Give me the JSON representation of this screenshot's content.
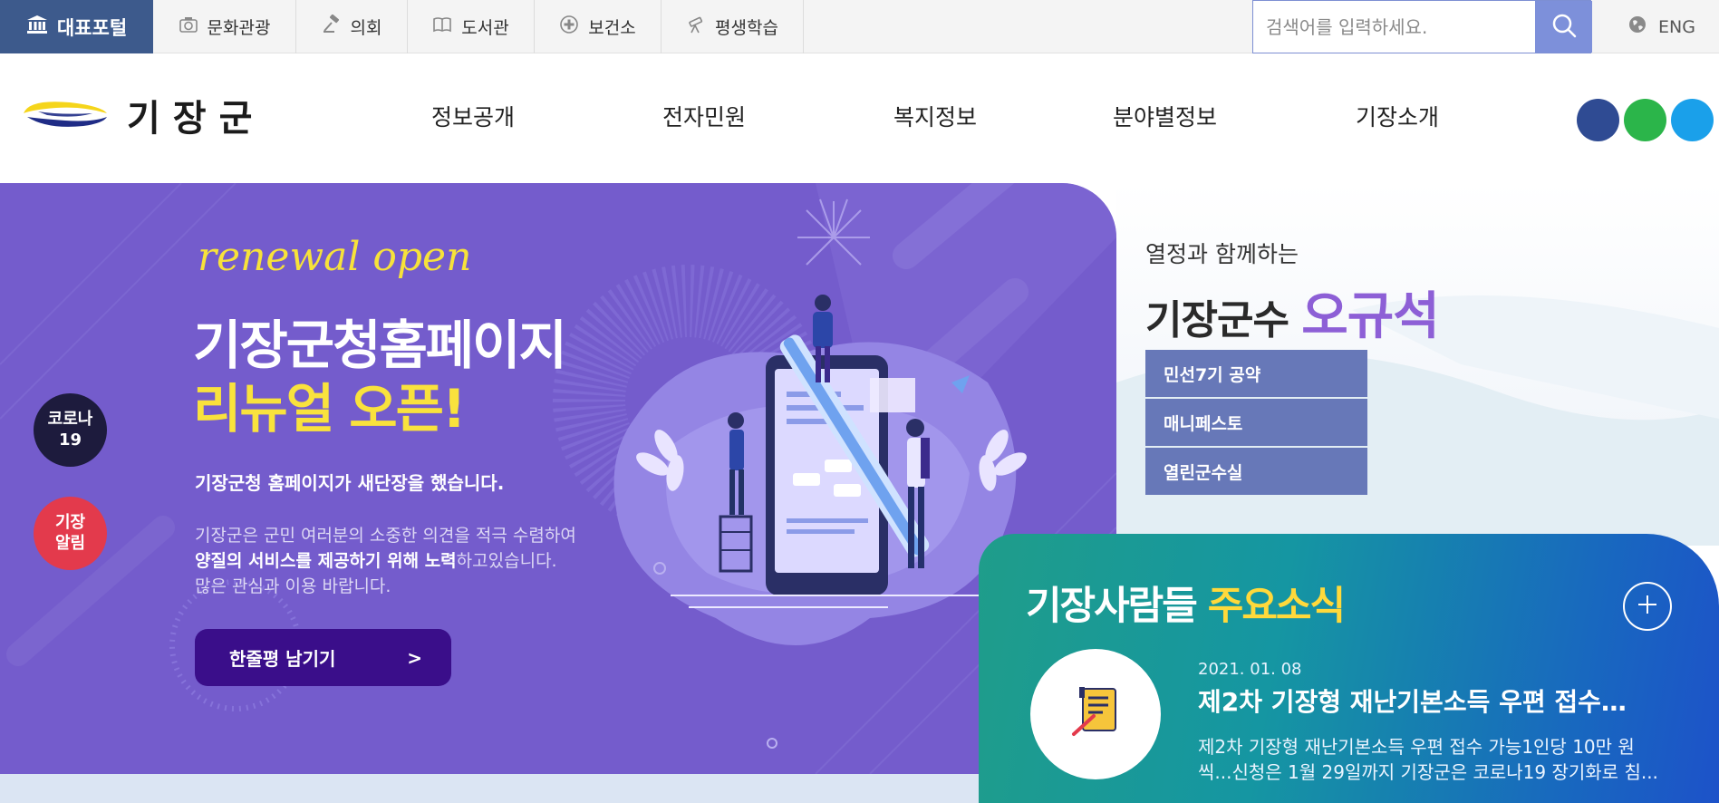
{
  "top_bar": {
    "portal_tab": "대표포털",
    "items": [
      {
        "label": "문화관광",
        "icon": "camera-icon"
      },
      {
        "label": "의회",
        "icon": "gavel-icon"
      },
      {
        "label": "도서관",
        "icon": "book-icon"
      },
      {
        "label": "보건소",
        "icon": "medical-cross-icon"
      },
      {
        "label": "평생학습",
        "icon": "telescope-icon"
      }
    ],
    "search_placeholder": "검색어를 입력하세요.",
    "language": "ENG"
  },
  "header": {
    "logo_text": "기장군",
    "nav": [
      "정보공개",
      "전자민원",
      "복지정보",
      "분야별정보",
      "기장소개"
    ],
    "social_colors": [
      "#2f4b93",
      "#2bb54a",
      "#1aa0ea"
    ]
  },
  "banner": {
    "script_title": "renewal open",
    "headline_1": "기장군청홈페이지",
    "headline_2": "리뉴얼 오픈!",
    "lead": "기장군청 홈페이지가 새단장을 했습니다.",
    "desc_1": "기장군은 군민 여러분의 소중한 의견을 적극 수렴하여",
    "desc_2_bold": "양질의 서비스를 제공하기 위해 노력",
    "desc_2_rest": "하고있습니다.",
    "desc_3": "많은 관심과 이용 바랍니다.",
    "button_label": "한줄평 남기기",
    "button_arrow": ">",
    "background_color": "#745ccc"
  },
  "side_buttons": {
    "covid_line1": "코로나",
    "covid_line2": "19",
    "notice_line1": "기장",
    "notice_line2": "알림"
  },
  "mayor": {
    "subtitle": "열정과 함께하는",
    "title_prefix": "기장군수",
    "title_name": "오규석",
    "links": [
      "민선7기 공약",
      "매니페스토",
      "열린군수실"
    ]
  },
  "news": {
    "title_part1": "기장사람들",
    "title_part2": "주요소식",
    "date": "2021. 01. 08",
    "headline": "제2차 기장형 재난기본소득 우편 접수…",
    "body_line1": "제2차 기장형 재난기본소득 우편 접수 가능1인당 10만 원",
    "body_line2": "씩...신청은 1월 29일까지   기장군은 코로나19 장기화로 침..."
  }
}
